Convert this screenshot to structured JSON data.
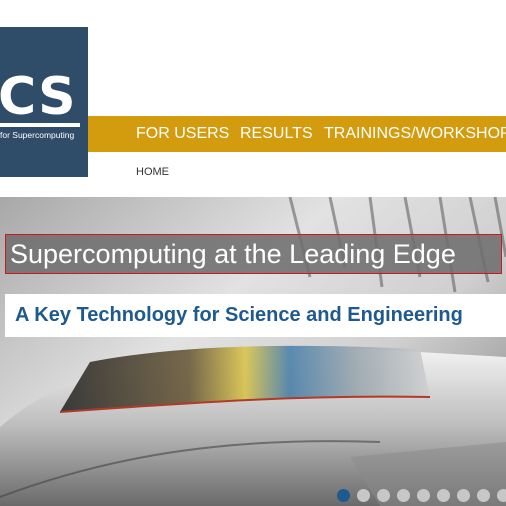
{
  "logo": {
    "letters": "CS",
    "tagline": "for Supercomputing",
    "color": "#2f4c69"
  },
  "nav": {
    "color": "#d39c0e",
    "items": [
      {
        "label": "FOR USERS"
      },
      {
        "label": "RESULTS"
      },
      {
        "label": "TRAININGS/WORKSHOPS"
      }
    ]
  },
  "breadcrumb": {
    "home": "HOME"
  },
  "hero": {
    "title": "Supercomputing at the Leading Edge",
    "subtitle": "A Key Technology for Science and Engineering",
    "slide_count": 9,
    "active_slide": 1,
    "accent": "#1f5a8e"
  }
}
